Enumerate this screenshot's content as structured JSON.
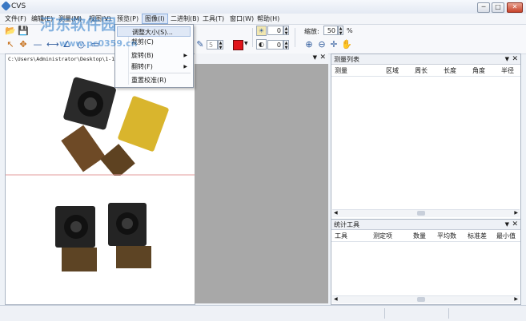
{
  "window": {
    "title": "CVS",
    "minimize": "─",
    "maximize": "□",
    "close": "✕"
  },
  "menubar": [
    {
      "label": "文件(F)"
    },
    {
      "label": "编辑(E)"
    },
    {
      "label": "测量(M)"
    },
    {
      "label": "视图(V)"
    },
    {
      "label": "预览(P)"
    },
    {
      "label": "图像(I)"
    },
    {
      "label": "二进制(B)"
    },
    {
      "label": "工具(T)"
    },
    {
      "label": "窗口(W)"
    },
    {
      "label": "帮助(H)"
    }
  ],
  "image_menu": [
    {
      "label": "调整大小(S)..."
    },
    {
      "label": "裁剪(C)"
    },
    {
      "label": "旋转(B)",
      "submenu": "▶"
    },
    {
      "label": "翻转(F)",
      "submenu": "▶"
    },
    {
      "label": "重置校准(R)"
    }
  ],
  "toolbar": {
    "spin1_value": "0",
    "spin2_value": "0",
    "line_width_value": "5",
    "zoom_label": "缩放:",
    "zoom_value": "50",
    "zoom_unit": "%",
    "color": "#e0141b"
  },
  "image_pane": {
    "path": "C:\\Users\\Administrator\\Desktop\\1-160"
  },
  "measure_panel": {
    "title": "测量列表",
    "columns": [
      "测量",
      "区域",
      "周长",
      "长度",
      "角度",
      "半径"
    ]
  },
  "stats_panel": {
    "title": "统计工具",
    "columns": [
      "工具",
      "测定项",
      "数量",
      "平均数",
      "标准差",
      "最小值"
    ]
  },
  "watermark": {
    "text": "河东软件园",
    "url": "www.pc0359.cn"
  }
}
